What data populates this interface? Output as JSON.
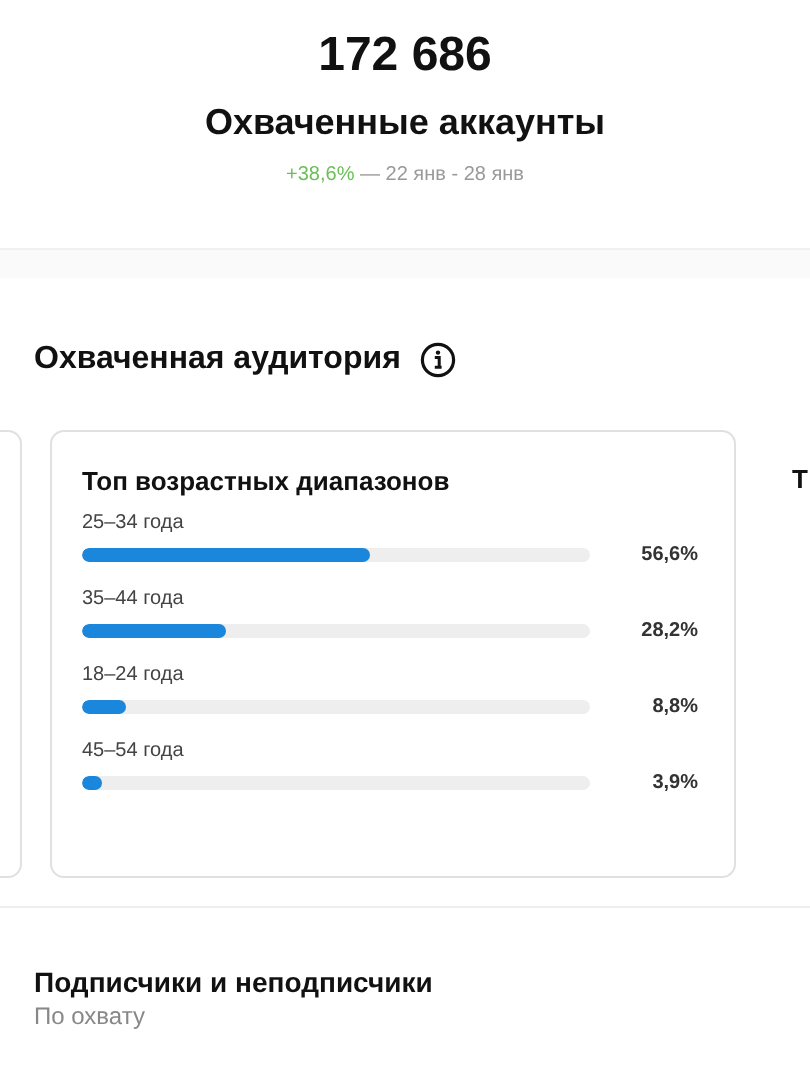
{
  "summary": {
    "value": "172 686",
    "title": "Охваченные аккаунты",
    "change": "+38,6%",
    "period": "— 22 янв - 28 янв"
  },
  "audience": {
    "title": "Охваченная аудитория",
    "cards": [
      {
        "kind": "edge"
      },
      {
        "kind": "bars",
        "title": "Топ возрастных диапазонов",
        "rows": [
          {
            "label": "25–34 года",
            "level": 0.566,
            "reading": "56,6%"
          },
          {
            "label": "35–44 года",
            "level": 0.282,
            "reading": "28,2%"
          },
          {
            "label": "18–24 года",
            "level": 0.088,
            "reading": "8,8%"
          },
          {
            "label": "45–54 года",
            "level": 0.039,
            "reading": "3,9%"
          }
        ]
      },
      {
        "kind": "cut",
        "title": "Т"
      }
    ]
  },
  "followers": {
    "title": "Подписчики и неподписчики",
    "subtitle": "По охвату"
  }
}
